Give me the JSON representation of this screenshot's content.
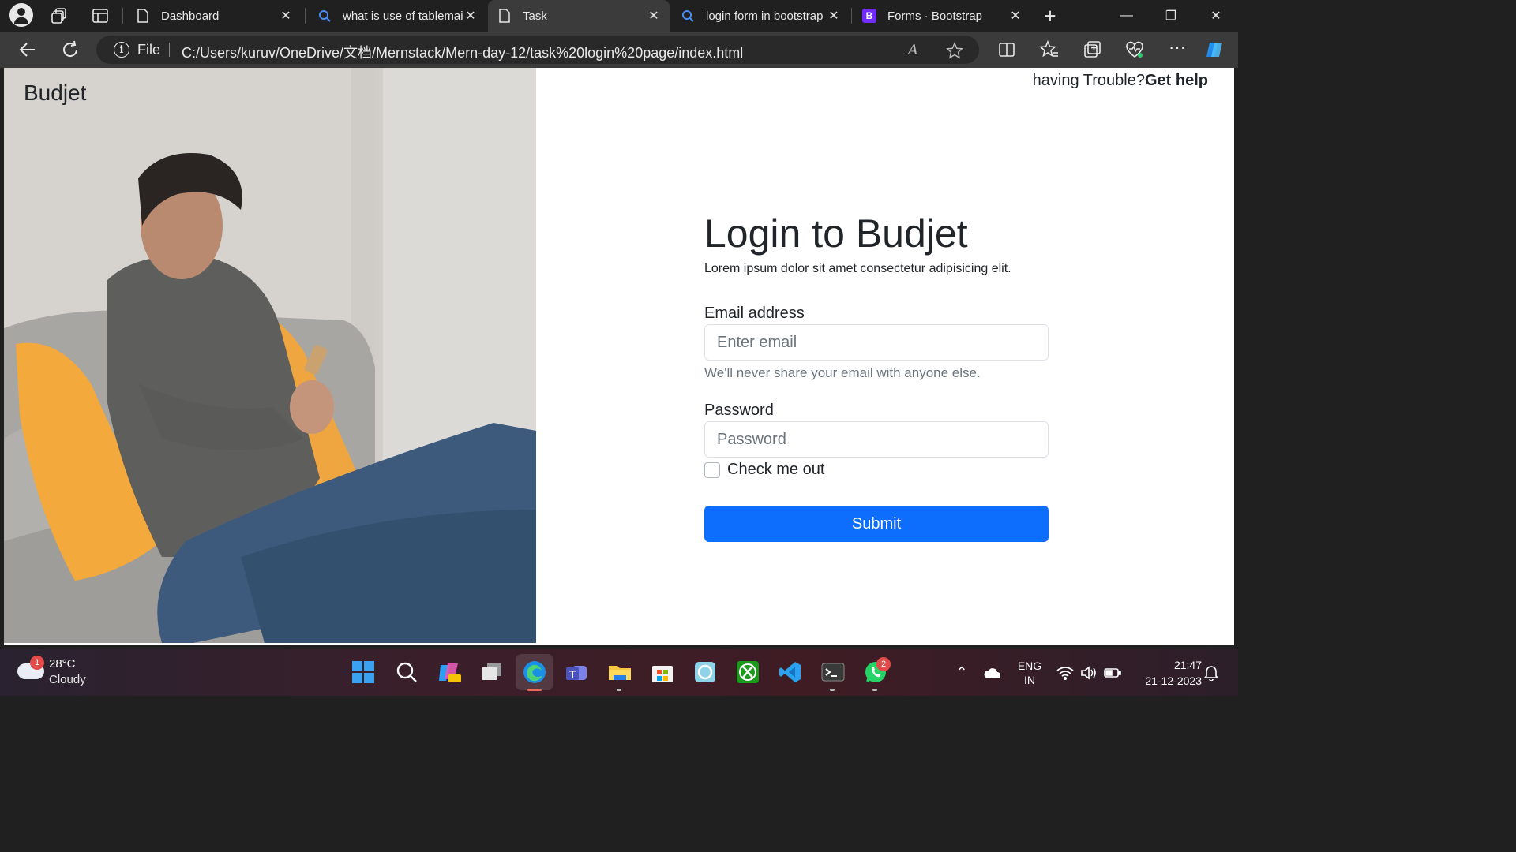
{
  "browser": {
    "tabs": [
      {
        "label": "Dashboard",
        "icon": "page-icon",
        "active": false
      },
      {
        "label": "what is use of tablemain",
        "icon": "search-icon",
        "active": false
      },
      {
        "label": "Task",
        "icon": "page-icon",
        "active": true
      },
      {
        "label": "login form in bootstrap",
        "icon": "search-icon",
        "active": false
      },
      {
        "label": "Forms · Bootstrap",
        "icon": "bootstrap-icon",
        "active": false
      }
    ],
    "bootstrap_badge": "B",
    "address": {
      "scheme_label": "File",
      "url": "C:/Users/kuruv/OneDrive/文档/Mernstack/Mern-day-12/task%20login%20page/index.html",
      "read_aloud": "A"
    }
  },
  "page": {
    "brand": "Budjet",
    "help_text": "having Trouble?",
    "help_link": "Get help",
    "form": {
      "title": "Login to Budjet",
      "subtitle": "Lorem ipsum dolor sit amet consectetur adipisicing elit.",
      "email_label": "Email address",
      "email_placeholder": "Enter email",
      "email_hint": "We'll never share your email with anyone else.",
      "password_label": "Password",
      "password_placeholder": "Password",
      "checkbox_label": "Check me out",
      "checkbox_checked": false,
      "submit_label": "Submit",
      "submit_color": "#0d6efd"
    }
  },
  "taskbar": {
    "weather": {
      "temp": "28°C",
      "condition": "Cloudy",
      "badge": "1"
    },
    "whatsapp_badge": "2",
    "lang": {
      "line1": "ENG",
      "line2": "IN"
    },
    "clock": {
      "time": "21:47",
      "date": "21-12-2023"
    }
  }
}
